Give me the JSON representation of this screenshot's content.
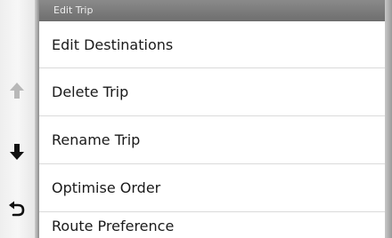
{
  "header": {
    "title": "Edit Trip"
  },
  "menu": {
    "items": [
      {
        "label": "Edit Destinations"
      },
      {
        "label": "Delete Trip"
      },
      {
        "label": "Rename Trip"
      },
      {
        "label": "Optimise Order"
      },
      {
        "label": "Route Preference"
      }
    ]
  },
  "scroll": {
    "up_icon": "arrow-up-icon",
    "up_state": "disabled",
    "down_icon": "arrow-down-icon",
    "back_icon": "back-icon"
  },
  "colors": {
    "header_bg": "#7a7a7a",
    "header_text": "#ededed",
    "item_text": "#1a1a1a",
    "divider": "#dadada",
    "icon_active": "#111111",
    "icon_disabled": "#b8b8b8"
  }
}
